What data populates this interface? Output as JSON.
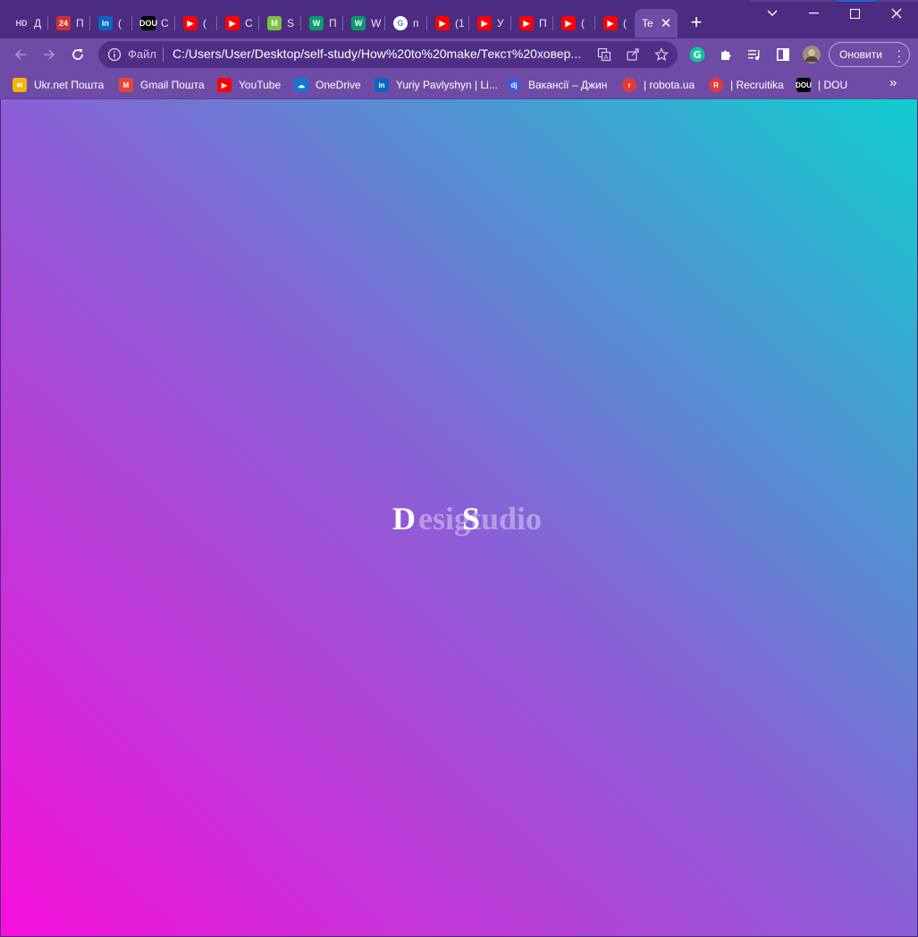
{
  "tabs": [
    {
      "favicon_text": "HD",
      "favicon_color": "#4b2c80",
      "title": "Д"
    },
    {
      "favicon_text": "24",
      "favicon_color": "#d32f2f",
      "title": "П"
    },
    {
      "favicon_text": "in",
      "favicon_color": "#0a66c2",
      "title": "("
    },
    {
      "favicon_text": "DOU",
      "favicon_color": "#000000",
      "title": "С"
    },
    {
      "favicon_text": "▶",
      "favicon_color": "#ff0000",
      "title": "("
    },
    {
      "favicon_text": "▶",
      "favicon_color": "#ff0000",
      "title": "С"
    },
    {
      "favicon_text": "M",
      "favicon_color": "#7bc142",
      "title": "S"
    },
    {
      "favicon_text": "W",
      "favicon_color": "#0a9a6a",
      "title": "П"
    },
    {
      "favicon_text": "W",
      "favicon_color": "#0a9a6a",
      "title": "W"
    },
    {
      "favicon_text": "G",
      "favicon_color": "#ffffff",
      "title": "п"
    },
    {
      "favicon_text": "▶",
      "favicon_color": "#ff0000",
      "title": "(1"
    },
    {
      "favicon_text": "▶",
      "favicon_color": "#ff0000",
      "title": "У"
    },
    {
      "favicon_text": "▶",
      "favicon_color": "#ff0000",
      "title": "П"
    },
    {
      "favicon_text": "▶",
      "favicon_color": "#ff0000",
      "title": "("
    },
    {
      "favicon_text": "▶",
      "favicon_color": "#ff0000",
      "title": "("
    }
  ],
  "active_tab": {
    "title": "Te"
  },
  "toolbar": {
    "site_info": "Файл",
    "url": "C:/Users/User/Desktop/self-study/How%20to%20make/Текст%20ховер...",
    "update_label": "Оновити"
  },
  "bookmarks": [
    {
      "label": "Ukr.net Пошта",
      "icon": "ukrnet-icon",
      "color": "#f5b400"
    },
    {
      "label": "Gmail Пошта",
      "icon": "gmail-icon",
      "color": "#ea4335"
    },
    {
      "label": "YouTube",
      "icon": "youtube-icon",
      "color": "#ff0000"
    },
    {
      "label": "OneDrive",
      "icon": "onedrive-icon",
      "color": "#0f78d4"
    },
    {
      "label": "Yuriy Pavlyshyn | Li...",
      "icon": "linkedin-icon",
      "color": "#0a66c2"
    },
    {
      "label": "Вакансії – Джин",
      "icon": "djinni-icon",
      "color": "#3f5bd6"
    },
    {
      "label": "| robota.ua",
      "icon": "robota-icon",
      "color": "#e53935"
    },
    {
      "label": "| Recruitika",
      "icon": "recruitika-icon",
      "color": "#e53935"
    },
    {
      "label": "| DOU",
      "icon": "dou-icon",
      "color": "#000000"
    }
  ],
  "page": {
    "ghost_text": "esigtudio",
    "solid_d": "D",
    "solid_s": "S"
  },
  "colors": {
    "gradient_bottom_left": "#f70fdb",
    "gradient_mid": "#8b5fd6",
    "gradient_top_right": "#10cdcf"
  }
}
